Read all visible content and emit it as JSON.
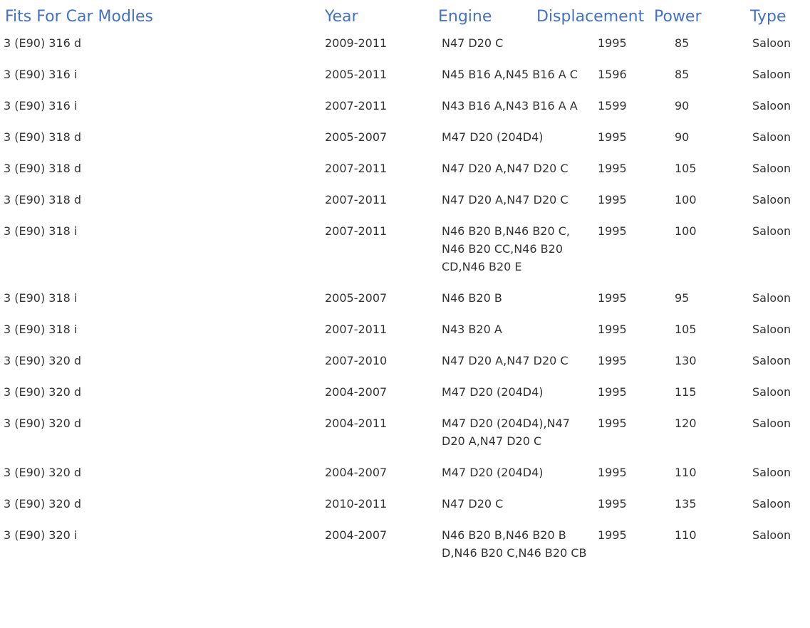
{
  "headers": {
    "model": "Fits For Car Modles",
    "year": "Year",
    "engine": "Engine",
    "displacement": "Displacement",
    "power": "Power",
    "type": "Type"
  },
  "rows": [
    {
      "model": "3 (E90) 316 d",
      "year": "2009-2011",
      "engine": "N47 D20 C",
      "displacement": "1995",
      "power": "85",
      "type": "Saloon"
    },
    {
      "model": "3 (E90) 316 i",
      "year": "2005-2011",
      "engine": "N45 B16 A,N45 B16 A C",
      "displacement": "1596",
      "power": "85",
      "type": "Saloon"
    },
    {
      "model": "3 (E90) 316 i",
      "year": "2007-2011",
      "engine": "N43 B16 A,N43 B16 A A",
      "displacement": "1599",
      "power": "90",
      "type": "Saloon"
    },
    {
      "model": "3 (E90) 318 d",
      "year": "2005-2007",
      "engine": "M47 D20 (204D4)",
      "displacement": "1995",
      "power": "90",
      "type": "Saloon"
    },
    {
      "model": "3 (E90) 318 d",
      "year": "2007-2011",
      "engine": "N47 D20 A,N47 D20 C",
      "displacement": "1995",
      "power": "105",
      "type": "Saloon"
    },
    {
      "model": "3 (E90) 318 d",
      "year": "2007-2011",
      "engine": "N47 D20 A,N47 D20 C",
      "displacement": "1995",
      "power": "100",
      "type": "Saloon"
    },
    {
      "model": "3 (E90) 318 i",
      "year": "2007-2011",
      "engine": "N46 B20 B,N46 B20 C, N46 B20 CC,N46 B20 CD,N46 B20 E",
      "displacement": "1995",
      "power": "100",
      "type": "Saloon"
    },
    {
      "model": "3 (E90) 318 i",
      "year": "2005-2007",
      "engine": "N46 B20 B",
      "displacement": "1995",
      "power": "95",
      "type": "Saloon"
    },
    {
      "model": "3 (E90) 318 i",
      "year": "2007-2011",
      "engine": "N43 B20 A",
      "displacement": "1995",
      "power": "105",
      "type": "Saloon"
    },
    {
      "model": "3 (E90) 320 d",
      "year": "2007-2010",
      "engine": "N47 D20 A,N47 D20 C",
      "displacement": "1995",
      "power": "130",
      "type": "Saloon"
    },
    {
      "model": "3 (E90) 320 d",
      "year": "2004-2007",
      "engine": "M47 D20 (204D4)",
      "displacement": "1995",
      "power": "115",
      "type": "Saloon"
    },
    {
      "model": "3 (E90) 320 d",
      "year": "2004-2011",
      "engine": "M47 D20 (204D4),N47 D20 A,N47 D20 C",
      "displacement": "1995",
      "power": "120",
      "type": "Saloon"
    },
    {
      "model": "3 (E90) 320 d",
      "year": "2004-2007",
      "engine": "M47 D20 (204D4)",
      "displacement": "1995",
      "power": "110",
      "type": "Saloon"
    },
    {
      "model": "3 (E90) 320 d",
      "year": "2010-2011",
      "engine": "N47 D20 C",
      "displacement": "1995",
      "power": "135",
      "type": "Saloon"
    },
    {
      "model": "3 (E90) 320 i",
      "year": "2004-2007",
      "engine": "N46 B20 B,N46 B20 B D,N46 B20 C,N46 B20 CB",
      "displacement": "1995",
      "power": "110",
      "type": "Saloon"
    }
  ],
  "colors": {
    "header_text": "#4472c4",
    "body_text": "#333333",
    "background": "#ffffff"
  }
}
